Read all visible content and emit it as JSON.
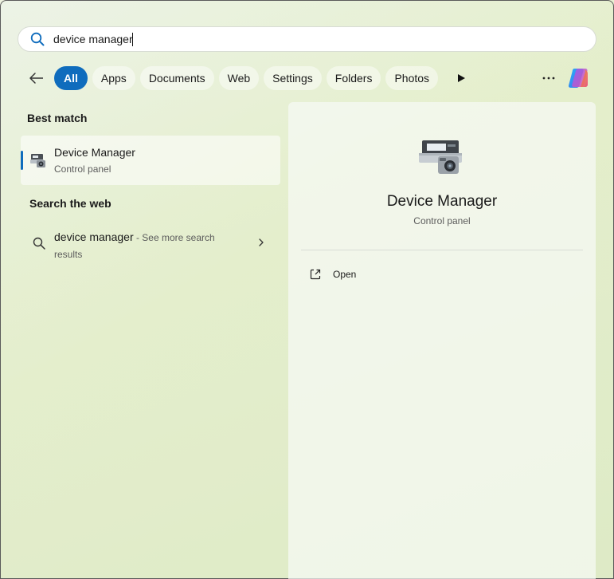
{
  "search": {
    "value": "device manager",
    "placeholder": ""
  },
  "filters": {
    "chips": [
      "All",
      "Apps",
      "Documents",
      "Web",
      "Settings",
      "Folders",
      "Photos"
    ],
    "active": "All"
  },
  "sections": {
    "best_match": "Best match",
    "search_web": "Search the web"
  },
  "best_match": {
    "title": "Device Manager",
    "subtitle": "Control panel"
  },
  "web_result": {
    "query": "device manager",
    "suffix": " - See more search results"
  },
  "preview": {
    "title": "Device Manager",
    "subtitle": "Control panel",
    "actions": [
      "Open"
    ]
  },
  "icons": {
    "search": "search-icon",
    "back": "back-arrow-icon",
    "play": "play-icon",
    "more": "more-icon",
    "copilot": "copilot-icon",
    "device_manager": "device-manager-icon",
    "chevron": "chevron-right-icon",
    "open": "open-external-icon"
  },
  "colors": {
    "accent": "#0f6cbd"
  }
}
